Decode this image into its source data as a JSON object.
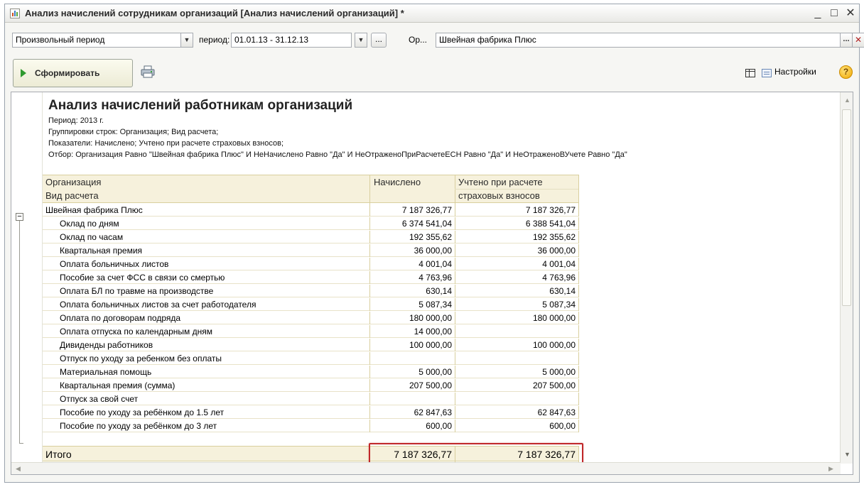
{
  "window": {
    "title": "Анализ начислений сотрудникам организаций [Анализ начислений организаций] *",
    "minimize": "_",
    "maximize": "□",
    "close": "✕"
  },
  "filters": {
    "period_type": "Произвольный период",
    "period_label": "период:",
    "period_value": "01.01.13 - 31.12.13",
    "ellipsis": "...",
    "org_label": "Ор...",
    "org_value": "Швейная фабрика Плюс",
    "clear": "✕"
  },
  "toolbar": {
    "generate_label": "Сформировать",
    "settings_label": "Настройки",
    "help": "?"
  },
  "report": {
    "title": "Анализ начислений работникам организаций",
    "period": "Период: 2013 г.",
    "grouping": "Группировки строк: Организация; Вид расчета;",
    "indicators": "Показатели: Начислено; Учтено при расчете страховых взносов;",
    "filter": "Отбор: Организация Равно \"Швейная фабрика Плюс\" И НеНачислено Равно \"Да\" И НеОтраженоПриРасчетеЕСН Равно \"Да\" И НеОтраженоВУчете Равно \"Да\"",
    "headers": {
      "org": "Организация",
      "calc_type": "Вид расчета",
      "accrued": "Начислено",
      "insured_1": "Учтено при расчете",
      "insured_2": "страховых взносов"
    },
    "group": {
      "name": "Швейная фабрика Плюс",
      "accrued": "7 187 326,77",
      "insured": "7 187 326,77"
    },
    "rows": [
      {
        "name": "Оклад по дням",
        "accrued": "6 374 541,04",
        "insured": "6 388 541,04"
      },
      {
        "name": "Оклад по часам",
        "accrued": "192 355,62",
        "insured": "192 355,62"
      },
      {
        "name": "Квартальная премия",
        "accrued": "36 000,00",
        "insured": "36 000,00"
      },
      {
        "name": "Оплата больничных листов",
        "accrued": "4 001,04",
        "insured": "4 001,04"
      },
      {
        "name": "Пособие за счет ФСС в связи со смертью",
        "accrued": "4 763,96",
        "insured": "4 763,96"
      },
      {
        "name": "Оплата БЛ по травме на производстве",
        "accrued": "630,14",
        "insured": "630,14"
      },
      {
        "name": "Оплата больничных листов за счет работодателя",
        "accrued": "5 087,34",
        "insured": "5 087,34"
      },
      {
        "name": "Оплата по договорам подряда",
        "accrued": "180 000,00",
        "insured": "180 000,00"
      },
      {
        "name": "Оплата отпуска по календарным дням",
        "accrued": "14 000,00",
        "insured": ""
      },
      {
        "name": "Дивиденды работников",
        "accrued": "100 000,00",
        "insured": "100 000,00"
      },
      {
        "name": "Отпуск по уходу за ребенком без оплаты",
        "accrued": "",
        "insured": ""
      },
      {
        "name": "Материальная помощь",
        "accrued": "5 000,00",
        "insured": "5 000,00"
      },
      {
        "name": "Квартальная премия (сумма)",
        "accrued": "207 500,00",
        "insured": "207 500,00"
      },
      {
        "name": "Отпуск за свой счет",
        "accrued": "",
        "insured": ""
      },
      {
        "name": "Пособие по уходу за ребёнком до 1.5 лет",
        "accrued": "62 847,63",
        "insured": "62 847,63"
      },
      {
        "name": "Пособие по уходу за ребёнком до 3 лет",
        "accrued": "600,00",
        "insured": "600,00"
      }
    ],
    "total": {
      "label": "Итого",
      "accrued": "7 187 326,77",
      "insured": "7 187 326,77"
    }
  }
}
